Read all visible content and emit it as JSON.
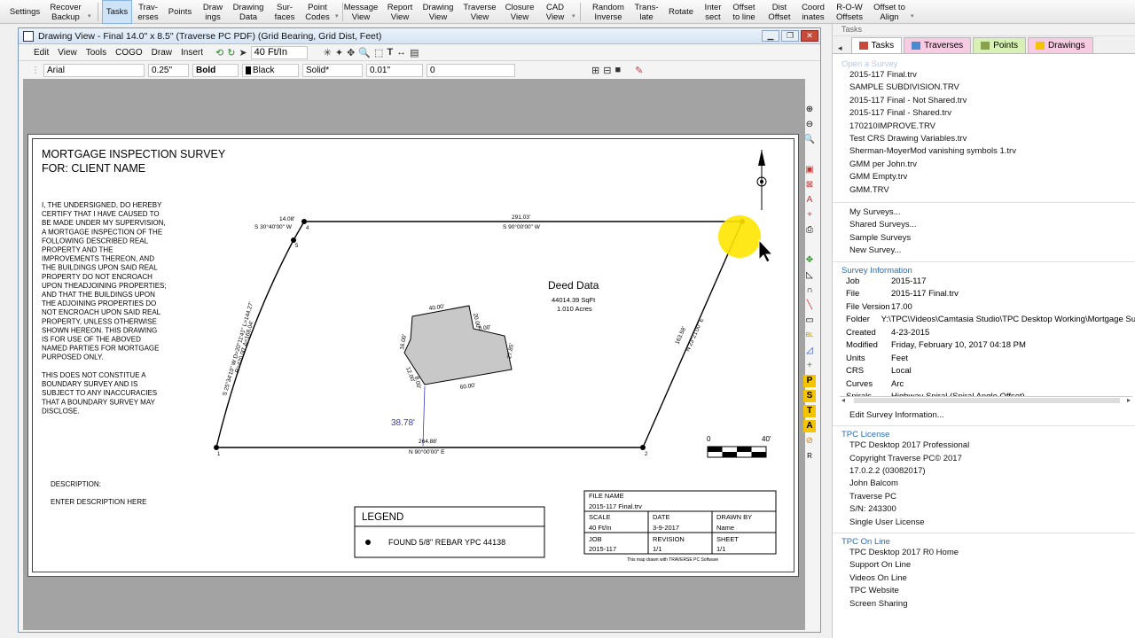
{
  "ribbon": {
    "buttons": [
      {
        "label": "Settings"
      },
      {
        "label": "Recover\nBackup"
      },
      {
        "label": "Tasks"
      },
      {
        "label": "Trav-\nerses"
      },
      {
        "label": "Points"
      },
      {
        "label": "Draw\nings"
      },
      {
        "label": "Drawing\nData"
      },
      {
        "label": "Sur-\nfaces"
      },
      {
        "label": "Point\nCodes"
      },
      {
        "label": "Message\nView"
      },
      {
        "label": "Report\nView"
      },
      {
        "label": "Drawing\nView"
      },
      {
        "label": "Traverse\nView"
      },
      {
        "label": "Closure\nView"
      },
      {
        "label": "CAD\nView"
      },
      {
        "label": "Random\nInverse"
      },
      {
        "label": "Trans-\nlate"
      },
      {
        "label": "Rotate"
      },
      {
        "label": "Inter\nsect"
      },
      {
        "label": "Offset\nto line"
      },
      {
        "label": "Dist\nOffset"
      },
      {
        "label": "Coord\ninates"
      },
      {
        "label": "R-O-W\nOffsets"
      },
      {
        "label": "Offset to\nAlign"
      }
    ]
  },
  "drawing_window": {
    "title": "Drawing View - Final  14.0\" x 8.5\" (Traverse PC PDF) (Grid Bearing, Grid Dist, Feet)",
    "menu": [
      "Edit",
      "View",
      "Tools",
      "COGO",
      "Draw",
      "Insert"
    ],
    "scale_select": "40 Ft/In",
    "font": "Arial",
    "text_height": "0.25\"",
    "weight": "Bold",
    "color": "Black",
    "linetype": "Solid*",
    "line_width": "0.01\"",
    "rotation": "0"
  },
  "sheet": {
    "title_line1": "MORTGAGE INSPECTION SURVEY",
    "title_line2": "FOR: CLIENT NAME",
    "certification": [
      "I, THE UNDERSIGNED, DO HEREBY",
      "CERTIFY THAT I HAVE CAUSED TO",
      "BE MADE UNDER MY SUPERVISION,",
      "A MORTGAGE INSPECTION OF THE",
      "FOLLOWING DESCRIBED REAL",
      "PROPERTY AND THE",
      "IMPROVEMENTS THEREON, AND",
      "THE BUILDINGS UPON SAID REAL",
      "PROPERTY DO NOT ENCROACH",
      "UPON THEADJOINING PROPERTIES;",
      "AND THAT THE BUILDINGS UPON",
      "THE ADJOINING PROPERTIES DO",
      "NOT ENCROACH UPON SAID REAL",
      "PROPERTY, UNLESS OTHERWISE",
      "SHOWN HEREON.  THIS DRAWING",
      "IS FOR USE OF THE ABOVED",
      "NAMED PARTIES FOR MORTGAGE",
      "PURPOSED ONLY."
    ],
    "disclaimer": [
      "THIS DOES NOT CONSTITUE A",
      "BOUNDARY SURVEY AND IS",
      "SUBJECT TO ANY INACCURACIES",
      "THAT A BOUNDARY SURVEY MAY",
      "DISCLOSE."
    ],
    "description_label": "DESCRIPTION:",
    "description_text": "ENTER DESCRIPTION HERE",
    "deed_title": "Deed Data",
    "deed_area_sqft": "44014.39 SqFt",
    "deed_area_acres": "1.010 Acres",
    "labels": {
      "top_dist": "291.03'",
      "top_bearing": "S 90°00'00\" W",
      "bottom_dist": "264.88'",
      "bottom_bearing": "N 90°00'00\" E",
      "short_dist": "14.08'",
      "short_bearing": "S 30°40'00\" W",
      "right_dist": "163.58'",
      "right_bearing": "N 23°21'00\" E",
      "curve": "S 25°34'10\" W D=20°11'41\" L=144.27'",
      "curve2": "R=420.00' Δ=168.04'",
      "offset": "38.78'",
      "b40": "40.00'",
      "b20": "20.00'",
      "b00": "0.00'",
      "b2785": "27.85'",
      "b60": "60.00'",
      "b16": "16.00'",
      "b12": "12.00'",
      "b8": "8.00'",
      "pt1": "1",
      "pt2": "2",
      "pt4": "4",
      "pt5": "5"
    },
    "scalebar_start": "0",
    "scalebar_end": "40'",
    "legend_title": "LEGEND",
    "legend_item": "FOUND 5/8\" REBAR YPC 44138",
    "title_block": {
      "file_name_label": "FILE NAME",
      "file_name": "2015-117 Final.trv",
      "scale_label": "SCALE",
      "scale": "40 Ft/In",
      "date_label": "DATE",
      "date": "3-9-2017",
      "drawn_by_label": "DRAWN BY",
      "drawn_by": "Name",
      "job_label": "JOB",
      "job": "2015-117",
      "revision_label": "REVISION",
      "revision": "1/1",
      "sheet_label": "SHEET",
      "sheet": "1/1",
      "footer": "This map drawn with TRAVERSE PC Software"
    }
  },
  "tasks_panel": {
    "header": "Tasks",
    "tabs": [
      "Tasks",
      "Traverses",
      "Points",
      "Drawings"
    ],
    "open_survey_title": "Open a Survey",
    "recent_files": [
      "2015-117 Final.trv",
      "SAMPLE SUBDIVISION.TRV",
      "2015-117 Final - Not Shared.trv",
      "2015-117 Final - Shared.trv",
      "170210IMPROVE.TRV",
      "Test CRS Drawing Variables.trv",
      "Sherman-MoyerMod vanishing symbols 1.trv",
      "GMM per John.trv",
      "GMM Empty.trv",
      "GMM.TRV"
    ],
    "survey_links": [
      "My Surveys...",
      "Shared Surveys...",
      "Sample Surveys",
      "New Survey..."
    ],
    "survey_info_title": "Survey Information",
    "survey_info": [
      {
        "k": "Job",
        "v": "2015-117"
      },
      {
        "k": "File",
        "v": "2015-117 Final.trv"
      },
      {
        "k": "File Version",
        "v": "17.00"
      },
      {
        "k": "Folder",
        "v": "Y:\\TPC\\Videos\\Camtasia Studio\\TPC Desktop Working\\Mortgage Su"
      },
      {
        "k": "Created",
        "v": "4-23-2015"
      },
      {
        "k": "Modified",
        "v": "Friday, February 10, 2017  04:18 PM"
      },
      {
        "k": "Units",
        "v": "Feet"
      },
      {
        "k": "CRS",
        "v": "Local"
      },
      {
        "k": "Curves",
        "v": "Arc"
      },
      {
        "k": "Spirals",
        "v": "Highway Spiral (Spiral Angle Offset)"
      }
    ],
    "edit_survey_info": "Edit Survey Information...",
    "license_title": "TPC License",
    "license": [
      "TPC Desktop 2017 Professional",
      "Copyright Traverse PC© 2017",
      "17.0.2.2 (03082017)",
      "John Balcom",
      "Traverse PC",
      "S/N: 243300",
      "Single User License"
    ],
    "online_title": "TPC On Line",
    "online": [
      "TPC Desktop 2017 R0 Home",
      "Support On Line",
      "Videos On Line",
      "TPC Website",
      "Screen Sharing"
    ]
  },
  "colors": {
    "accent": "#2a6bb5",
    "highlight": "#ffe600",
    "building": "#c8c8c8"
  }
}
